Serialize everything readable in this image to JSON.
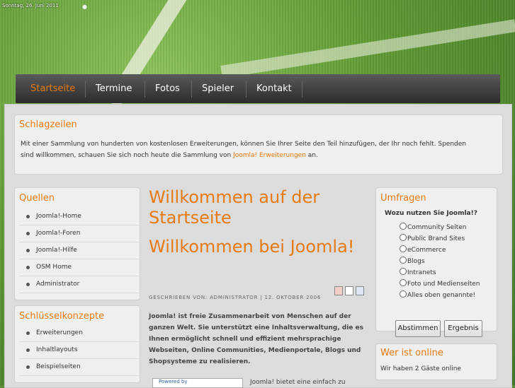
{
  "header": {
    "date": "Sonntag, 26. Juni 2011"
  },
  "nav": {
    "items": [
      "Startseite",
      "Termine",
      "Fotos",
      "Spieler",
      "Kontakt"
    ],
    "active_color": "#e87a12"
  },
  "headlines": {
    "title": "Schlagzeilen",
    "text_before": "Mit einer Sammlung von hunderten von kostenlosen Erweiterungen, können Sie Ihrer Seite den Teil hinzufügen, der Ihr noch fehlt. Spenden sind willkommen, schauen Sie sich noch heute die Sammlung von ",
    "link": "Joomla! Erweiterungen",
    "text_after": " an."
  },
  "sources": {
    "title": "Quellen",
    "items": [
      "Joomla!-Home",
      "Joomla!-Foren",
      "Joomla!-Hilfe",
      "OSM Home",
      "Administrator"
    ]
  },
  "concepts": {
    "title": "Schlüsselkonzepte",
    "items": [
      "Erweiterungen",
      "Inhaltlayouts",
      "Beispielseiten"
    ]
  },
  "article": {
    "heading1": "Willkommen auf der Startseite",
    "heading2": "Willkommen bei Joomla!",
    "meta": "GESCHRIEBEN VON: ADMINISTRATOR | 12. OKTOBER 2006",
    "intro": "Joomla! ist freie Zusammenarbeit von Menschen auf der ganzen Welt. Sie unterstützt eine Inhaltsverwaltung, die es Ihnen ermöglicht schnell und effizient mehrsprachige Webseiten, Online Communities, Medienportale, Blogs und Shopsysteme zu realisieren.",
    "powered": "Powered by",
    "continue": "Joomla! bietet eine einfach zu"
  },
  "poll": {
    "title": "Umfragen",
    "question": "Wozu nutzen Sie Joomla!?",
    "options": [
      "Community Seiten",
      "Public Brand Sites",
      "eCommerce",
      "Blogs",
      "Intranets",
      "Foto und Medienseiten",
      "Alles oben genannte!"
    ],
    "vote": "Abstimmen",
    "results": "Ergebnis"
  },
  "online": {
    "title": "Wer ist online",
    "text": "Wir haben 2 Gäste online"
  }
}
